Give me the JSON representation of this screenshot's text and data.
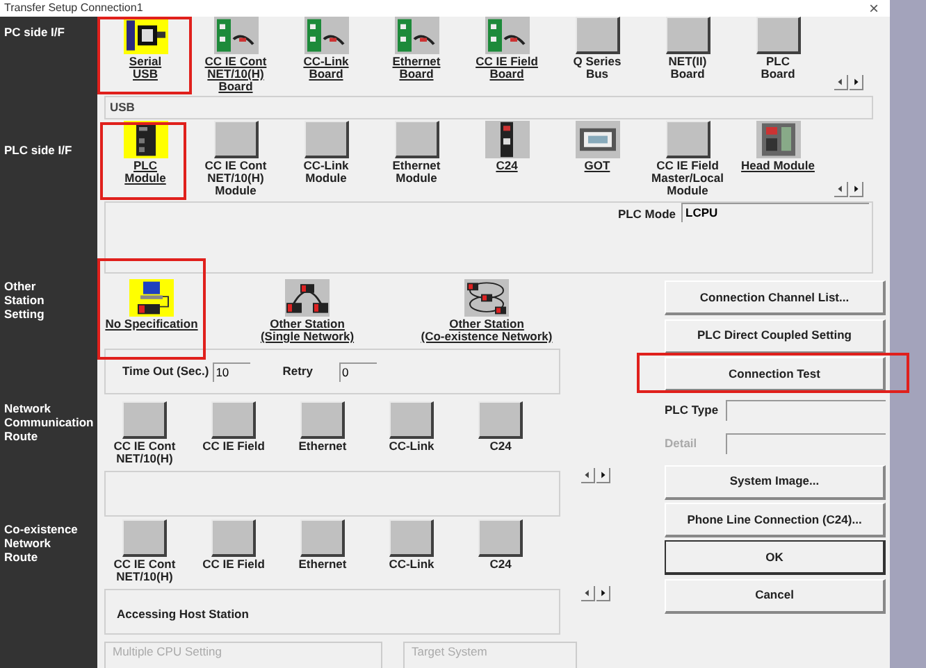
{
  "window": {
    "title": "Transfer Setup Connection1",
    "close": "×"
  },
  "pc_side": {
    "label": "PC side I/F",
    "items": [
      {
        "label": "Serial\nUSB",
        "kind": "serial",
        "selected": true,
        "enabled": true,
        "highlighted": true
      },
      {
        "label": "CC IE Cont\nNET/10(H)\nBoard",
        "kind": "board",
        "selected": false,
        "enabled": true,
        "highlighted": false
      },
      {
        "label": "CC-Link\nBoard",
        "kind": "board",
        "selected": false,
        "enabled": true,
        "highlighted": false
      },
      {
        "label": "Ethernet\nBoard",
        "kind": "board",
        "selected": false,
        "enabled": true,
        "highlighted": false
      },
      {
        "label": "CC IE Field\nBoard",
        "kind": "board",
        "selected": false,
        "enabled": true,
        "highlighted": false
      },
      {
        "label": "Q Series\nBus",
        "kind": "blank",
        "selected": false,
        "enabled": false,
        "highlighted": false
      },
      {
        "label": "NET(II)\nBoard",
        "kind": "blank",
        "selected": false,
        "enabled": false,
        "highlighted": false
      },
      {
        "label": "PLC\nBoard",
        "kind": "blank",
        "selected": false,
        "enabled": false,
        "highlighted": false
      }
    ]
  },
  "pc_detail": {
    "value": "USB"
  },
  "plc_side": {
    "label": "PLC side I/F",
    "items": [
      {
        "label": "PLC\nModule",
        "kind": "plc",
        "selected": true,
        "enabled": true,
        "highlighted": true
      },
      {
        "label": "CC IE Cont\nNET/10(H)\nModule",
        "kind": "blank",
        "selected": false,
        "enabled": false,
        "highlighted": false
      },
      {
        "label": "CC-Link\nModule",
        "kind": "blank",
        "selected": false,
        "enabled": false,
        "highlighted": false
      },
      {
        "label": "Ethernet\nModule",
        "kind": "blank",
        "selected": false,
        "enabled": false,
        "highlighted": false
      },
      {
        "label": "C24",
        "kind": "slim",
        "selected": false,
        "enabled": true,
        "highlighted": false
      },
      {
        "label": "GOT",
        "kind": "panel",
        "selected": false,
        "enabled": true,
        "highlighted": false
      },
      {
        "label": "CC IE Field\nMaster/Local\nModule",
        "kind": "blank",
        "selected": false,
        "enabled": false,
        "highlighted": false
      },
      {
        "label": "Head Module",
        "kind": "head",
        "selected": false,
        "enabled": true,
        "highlighted": false
      }
    ],
    "plc_mode": {
      "label": "PLC Mode",
      "value": "LCPU"
    }
  },
  "other_station": {
    "label": "Other\nStation\nSetting",
    "items": [
      {
        "label": "No Specification",
        "kind": "station",
        "selected": true,
        "enabled": true,
        "highlighted": true
      },
      {
        "label": "Other Station\n(Single Network)",
        "kind": "ring",
        "selected": false,
        "enabled": true,
        "highlighted": false
      },
      {
        "label": "Other Station\n(Co-existence Network)",
        "kind": "dual",
        "selected": false,
        "enabled": true,
        "highlighted": false
      }
    ],
    "timeout": {
      "label": "Time Out (Sec.)",
      "value": "10"
    },
    "retry": {
      "label": "Retry",
      "value": "0"
    }
  },
  "network_route": {
    "label": "Network\nCommunication\nRoute",
    "items": [
      {
        "label": "CC IE Cont\nNET/10(H)",
        "kind": "blank",
        "selected": false,
        "enabled": false,
        "highlighted": false
      },
      {
        "label": "CC IE Field",
        "kind": "blank",
        "selected": false,
        "enabled": false,
        "highlighted": false
      },
      {
        "label": "Ethernet",
        "kind": "blank",
        "selected": false,
        "enabled": false,
        "highlighted": false
      },
      {
        "label": "CC-Link",
        "kind": "blank",
        "selected": false,
        "enabled": false,
        "highlighted": false
      },
      {
        "label": "C24",
        "kind": "blank",
        "selected": false,
        "enabled": false,
        "highlighted": false
      }
    ]
  },
  "coexistence_route": {
    "label": "Co-existence\nNetwork\nRoute",
    "items": [
      {
        "label": "CC IE Cont\nNET/10(H)",
        "kind": "blank",
        "selected": false,
        "enabled": false,
        "highlighted": false
      },
      {
        "label": "CC IE Field",
        "kind": "blank",
        "selected": false,
        "enabled": false,
        "highlighted": false
      },
      {
        "label": "Ethernet",
        "kind": "blank",
        "selected": false,
        "enabled": false,
        "highlighted": false
      },
      {
        "label": "CC-Link",
        "kind": "blank",
        "selected": false,
        "enabled": false,
        "highlighted": false
      },
      {
        "label": "C24",
        "kind": "blank",
        "selected": false,
        "enabled": false,
        "highlighted": false
      }
    ],
    "status": "Accessing Host Station"
  },
  "group_boxes": [
    {
      "label": "Multiple CPU Setting",
      "disabled": true
    },
    {
      "label": "Target System",
      "disabled": true
    }
  ],
  "buttons_top": [
    {
      "label": "Connection Channel List...",
      "highlighted": false,
      "default": false
    },
    {
      "label": "PLC Direct Coupled Setting",
      "highlighted": false,
      "default": false
    },
    {
      "label": "Connection Test",
      "highlighted": true,
      "default": false
    }
  ],
  "plc_type": {
    "label": "PLC Type",
    "disabled": false
  },
  "detail": {
    "label": "Detail",
    "disabled": true
  },
  "buttons_bottom": [
    {
      "label": "System Image...",
      "highlighted": false,
      "default": false
    },
    {
      "label": "Phone Line Connection (C24)...",
      "highlighted": false,
      "default": false
    },
    {
      "label": "OK",
      "highlighted": false,
      "default": true
    },
    {
      "label": "Cancel",
      "highlighted": false,
      "default": false
    }
  ]
}
